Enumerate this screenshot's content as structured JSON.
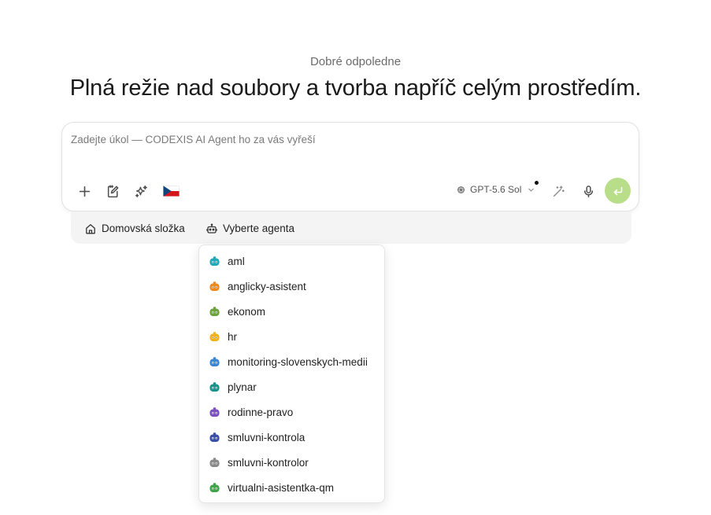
{
  "greeting": "Dobré odpoledne",
  "headline": "Plná režie nad soubory a tvorba napříč celým prostředím.",
  "composer": {
    "placeholder": "Zadejte úkol — CODEXIS AI Agent ho za vás vyřeší",
    "value": "",
    "model_label": "GPT-5.6 Sol"
  },
  "subbar": {
    "home_label": "Domovská složka",
    "agent_label": "Vyberte agenta"
  },
  "agents": [
    {
      "label": "aml",
      "color": "#1fa8b8"
    },
    {
      "label": "anglicky-asistent",
      "color": "#f08a1c"
    },
    {
      "label": "ekonom",
      "color": "#6aa33a"
    },
    {
      "label": "hr",
      "color": "#f2b21a"
    },
    {
      "label": "monitoring-slovenskych-medii",
      "color": "#3a86d6"
    },
    {
      "label": "plynar",
      "color": "#17938c"
    },
    {
      "label": "rodinne-pravo",
      "color": "#7a4fc2"
    },
    {
      "label": "smluvni-kontrola",
      "color": "#3a4ea8"
    },
    {
      "label": "smluvni-kontrolor",
      "color": "#8a8a8a"
    },
    {
      "label": "virtualni-asistentka-qm",
      "color": "#3fa348"
    }
  ],
  "colors": {
    "send_button": "#b9de8a",
    "flag_white": "#ffffff",
    "flag_red": "#d7141a",
    "flag_blue": "#11457e"
  }
}
